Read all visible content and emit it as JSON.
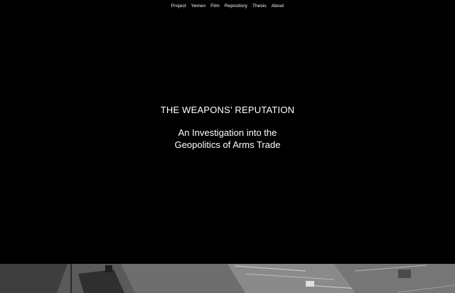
{
  "nav": {
    "items": [
      {
        "label": "Project"
      },
      {
        "label": "Yemen"
      },
      {
        "label": "Film"
      },
      {
        "label": "Repository"
      },
      {
        "label": "Thesis"
      },
      {
        "label": "About"
      }
    ]
  },
  "hero": {
    "title": "THE WEAPONS’ REPUTATION",
    "subtitle_line1": "An Investigation into the",
    "subtitle_line2": "Geopolitics of Arms Trade"
  },
  "colors": {
    "background": "#000000",
    "text": "#ffffff"
  }
}
